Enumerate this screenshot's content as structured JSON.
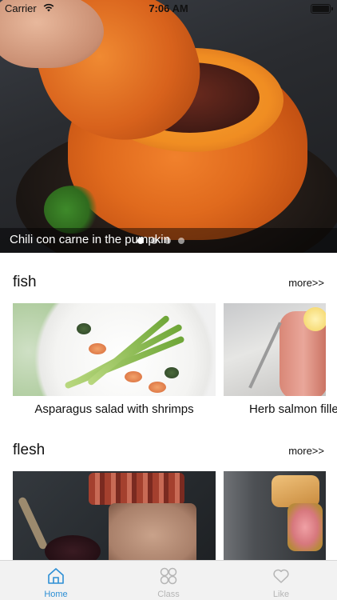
{
  "status_bar": {
    "carrier": "Carrier",
    "time": "7:06 AM",
    "battery_level": 1.0
  },
  "banner": {
    "caption": "Chili con carne in the pumpkin",
    "page_count": 4,
    "active_page": 1
  },
  "sections": [
    {
      "title": "fish",
      "more_label": "more>>",
      "items": [
        {
          "label": "Asparagus salad with shrimps",
          "image": "asparagus-shrimp-photo"
        },
        {
          "label": "Herb salmon fillet",
          "image": "herb-salmon-photo"
        }
      ]
    },
    {
      "title": "flesh",
      "more_label": "more>>",
      "items": [
        {
          "label": "",
          "image": "terrine-photo"
        },
        {
          "label": "",
          "image": "beef-wellington-photo"
        }
      ]
    }
  ],
  "tab_bar": {
    "active": "home",
    "accent_color": "#2d8fd5",
    "inactive_color": "#b5b5b5",
    "tabs": [
      {
        "id": "home",
        "label": "Home",
        "icon": "home-icon"
      },
      {
        "id": "class",
        "label": "Class",
        "icon": "grid-icon"
      },
      {
        "id": "like",
        "label": "Like",
        "icon": "heart-icon"
      }
    ]
  }
}
